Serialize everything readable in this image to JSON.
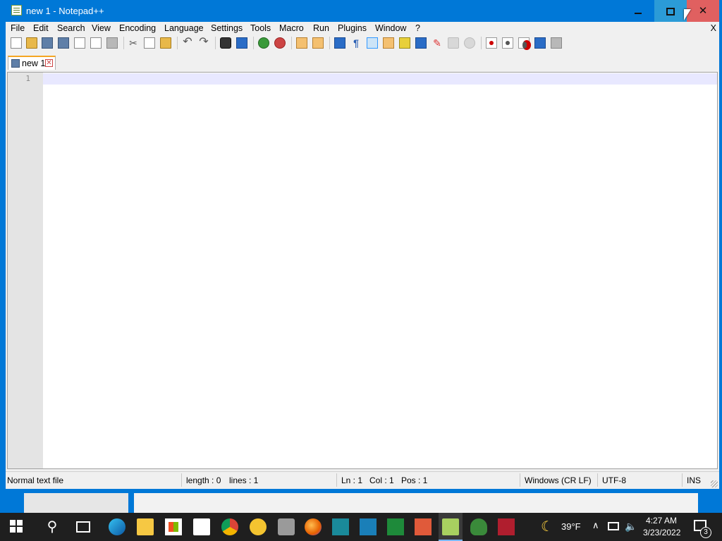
{
  "window": {
    "title": "new 1 - Notepad++",
    "controls": {
      "minimize": "minimize",
      "maximize": "maximize",
      "close": "✕"
    }
  },
  "menu": {
    "items": [
      "File",
      "Edit",
      "Search",
      "View",
      "Encoding",
      "Language",
      "Settings",
      "Tools",
      "Macro",
      "Run",
      "Plugins",
      "Window",
      "?"
    ],
    "close_doc": "X"
  },
  "tabs": [
    {
      "label": "new 1",
      "close": "✕"
    }
  ],
  "editor": {
    "line_numbers": [
      "1"
    ],
    "content": ""
  },
  "statusbar": {
    "file_type": "Normal text file",
    "length": "length : 0",
    "lines": "lines : 1",
    "ln": "Ln : 1",
    "col": "Col : 1",
    "pos": "Pos : 1",
    "eol": "Windows (CR LF)",
    "encoding": "UTF-8",
    "mode": "INS"
  },
  "taskbar": {
    "weather_temp": "39°F",
    "time": "4:27 AM",
    "date": "3/23/2022",
    "notification_count": "3",
    "icons": [
      "start",
      "search",
      "task-view",
      "edge",
      "file-explorer",
      "store",
      "mail",
      "chrome",
      "chromium",
      "gimp",
      "firefox",
      "fork",
      "briefcase",
      "chart",
      "health",
      "notepad-plus-plus",
      "gecko",
      "reader"
    ]
  },
  "colors": {
    "titlebar": "#0078d7",
    "close_hover": "#e06060",
    "current_line": "#e8e8ff",
    "tab_accent": "#f5a623",
    "taskbar": "#1f1f1f"
  }
}
